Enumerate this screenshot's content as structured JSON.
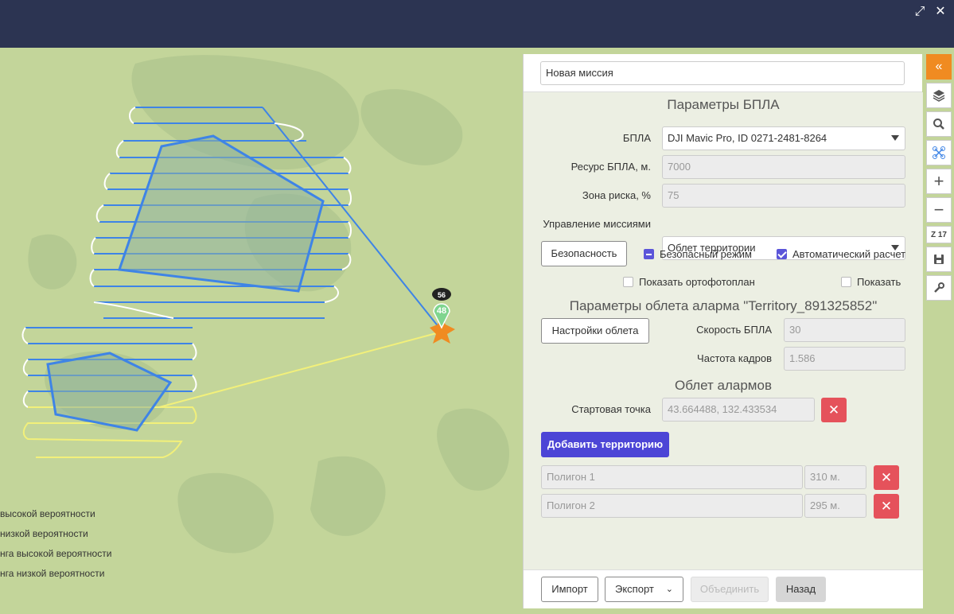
{
  "window": {
    "maximize_icon": "expand-icon",
    "close_icon": "close-icon"
  },
  "map": {
    "marker_cluster_count": "56",
    "marker_count": "48",
    "legend": [
      "высокой вероятности",
      "низкой вероятности",
      "нга высокой вероятности",
      "нга низкой вероятности"
    ]
  },
  "panel": {
    "mission_name": "Новая миссия",
    "uav_params_title": "Параметры БПЛА",
    "uav_label": "БПЛА",
    "uav_value": "DJI Mavic Pro, ID 0271-2481-8264",
    "resource_label": "Ресурс БПЛА, м.",
    "resource_value": "7000",
    "risk_label": "Зона риска, %",
    "risk_value": "75",
    "mission_control_label": "Управление миссиями",
    "mission_control_value": "Облет территории",
    "safety_button": "Безопасность",
    "safe_mode_label": "Безопасный режим",
    "auto_calc_label": "Автоматический расчет",
    "show_ortho_label": "Показать ортофотоплан",
    "show_label": "Показать",
    "alarm_params_title": "Параметры облета аларма  \"Territory_891325852\"",
    "flight_settings_button": "Настройки облета",
    "speed_label": "Скорость БПЛА",
    "speed_value": "30",
    "frame_rate_label": "Частота кадров",
    "frame_rate_value": "1.586",
    "alarms_title": "Облет алармов",
    "start_point_label": "Стартовая точка",
    "start_point_value": "43.664488, 132.433534",
    "add_territory_button": "Добавить территорию",
    "polygons": [
      {
        "name": "Полигон 1",
        "distance": "310 м."
      },
      {
        "name": "Полигон 2",
        "distance": "295 м."
      }
    ],
    "footer": {
      "import": "Импорт",
      "export": "Экспорт",
      "merge": "Объединить",
      "back": "Назад"
    }
  },
  "toolbar": {
    "zoom_level": "Z 17",
    "icons": [
      "collapse-icon",
      "layers-icon",
      "search-icon",
      "drone-icon",
      "zoom-in-icon",
      "zoom-out-icon",
      "save-icon",
      "wrench-icon"
    ]
  },
  "colors": {
    "header": "#2c3452",
    "accent": "#f08b21",
    "primary": "#4c45d6",
    "danger": "#e5525b",
    "route": "#3e84e6",
    "alarm_route": "#f2f07a"
  }
}
